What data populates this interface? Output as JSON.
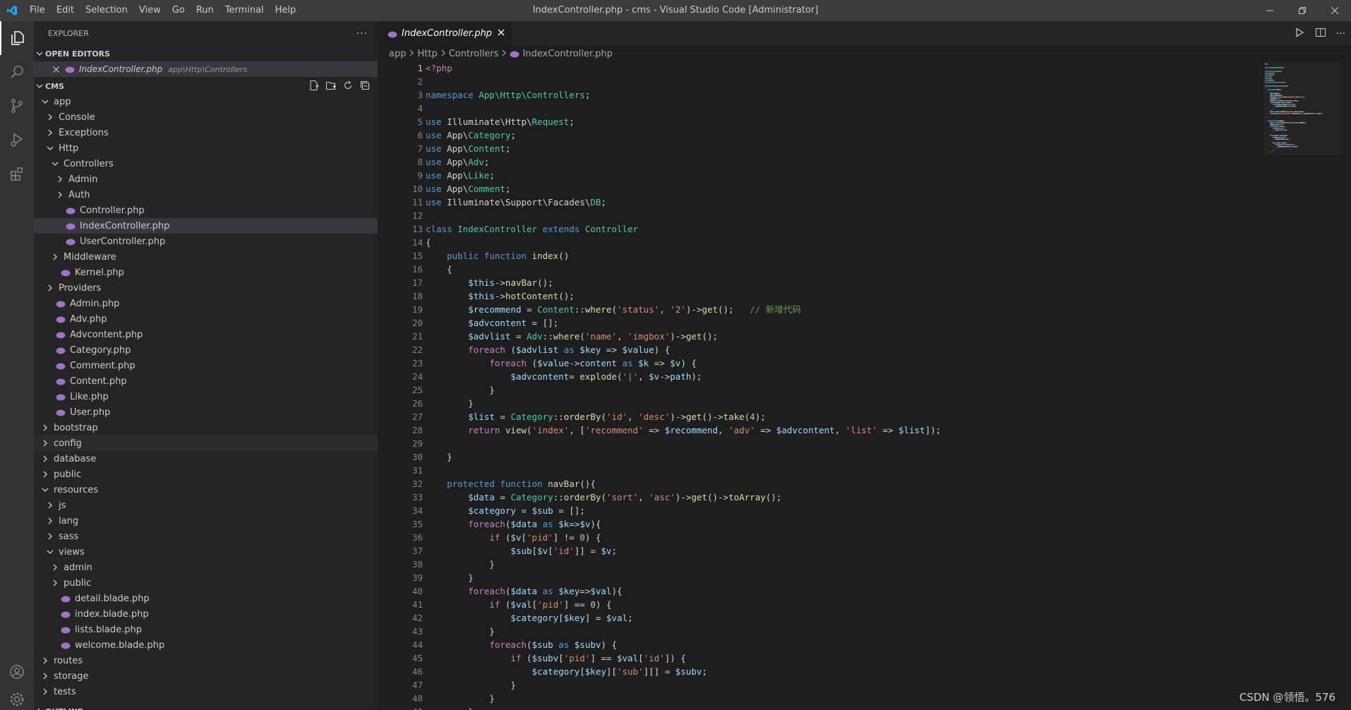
{
  "window": {
    "title": "IndexController.php - cms - Visual Studio Code [Administrator]",
    "menu": [
      "File",
      "Edit",
      "Selection",
      "View",
      "Go",
      "Run",
      "Terminal",
      "Help"
    ]
  },
  "sidebar": {
    "title": "EXPLORER",
    "open_editors_label": "OPEN EDITORS",
    "open_editor": {
      "name": "IndexController.php",
      "path": "app\\Http\\Controllers"
    },
    "project_label": "CMS",
    "tree": [
      {
        "label": "app",
        "depth": 0,
        "kind": "folder-open"
      },
      {
        "label": "Console",
        "depth": 1,
        "kind": "folder"
      },
      {
        "label": "Exceptions",
        "depth": 1,
        "kind": "folder"
      },
      {
        "label": "Http",
        "depth": 1,
        "kind": "folder-open"
      },
      {
        "label": "Controllers",
        "depth": 2,
        "kind": "folder-open"
      },
      {
        "label": "Admin",
        "depth": 3,
        "kind": "folder"
      },
      {
        "label": "Auth",
        "depth": 3,
        "kind": "folder"
      },
      {
        "label": "Controller.php",
        "depth": 3,
        "kind": "file"
      },
      {
        "label": "IndexController.php",
        "depth": 3,
        "kind": "file",
        "selected": true
      },
      {
        "label": "UserController.php",
        "depth": 3,
        "kind": "file"
      },
      {
        "label": "Middleware",
        "depth": 2,
        "kind": "folder"
      },
      {
        "label": "Kernel.php",
        "depth": 2,
        "kind": "file"
      },
      {
        "label": "Providers",
        "depth": 1,
        "kind": "folder"
      },
      {
        "label": "Admin.php",
        "depth": 1,
        "kind": "file"
      },
      {
        "label": "Adv.php",
        "depth": 1,
        "kind": "file"
      },
      {
        "label": "Advcontent.php",
        "depth": 1,
        "kind": "file"
      },
      {
        "label": "Category.php",
        "depth": 1,
        "kind": "file"
      },
      {
        "label": "Comment.php",
        "depth": 1,
        "kind": "file"
      },
      {
        "label": "Content.php",
        "depth": 1,
        "kind": "file"
      },
      {
        "label": "Like.php",
        "depth": 1,
        "kind": "file"
      },
      {
        "label": "User.php",
        "depth": 1,
        "kind": "file"
      },
      {
        "label": "bootstrap",
        "depth": 0,
        "kind": "folder"
      },
      {
        "label": "config",
        "depth": 0,
        "kind": "folder",
        "hover": true
      },
      {
        "label": "database",
        "depth": 0,
        "kind": "folder"
      },
      {
        "label": "public",
        "depth": 0,
        "kind": "folder"
      },
      {
        "label": "resources",
        "depth": 0,
        "kind": "folder-open"
      },
      {
        "label": "js",
        "depth": 1,
        "kind": "folder"
      },
      {
        "label": "lang",
        "depth": 1,
        "kind": "folder"
      },
      {
        "label": "sass",
        "depth": 1,
        "kind": "folder"
      },
      {
        "label": "views",
        "depth": 1,
        "kind": "folder-open"
      },
      {
        "label": "admin",
        "depth": 2,
        "kind": "folder"
      },
      {
        "label": "public",
        "depth": 2,
        "kind": "folder"
      },
      {
        "label": "detail.blade.php",
        "depth": 2,
        "kind": "file"
      },
      {
        "label": "index.blade.php",
        "depth": 2,
        "kind": "file"
      },
      {
        "label": "lists.blade.php",
        "depth": 2,
        "kind": "file"
      },
      {
        "label": "welcome.blade.php",
        "depth": 2,
        "kind": "file"
      },
      {
        "label": "routes",
        "depth": 0,
        "kind": "folder"
      },
      {
        "label": "storage",
        "depth": 0,
        "kind": "folder"
      },
      {
        "label": "tests",
        "depth": 0,
        "kind": "folder"
      }
    ],
    "outline_label": "OUTLINE"
  },
  "editor": {
    "tab_label": "IndexController.php",
    "breadcrumb": [
      "app",
      "Http",
      "Controllers",
      "IndexController.php"
    ],
    "lines": [
      [
        [
          "c",
          "<?php"
        ]
      ],
      [],
      [
        [
          "k",
          "namespace "
        ],
        [
          "t",
          "App\\Http\\Controllers"
        ],
        [
          "p",
          ";"
        ]
      ],
      [],
      [
        [
          "k",
          "use "
        ],
        [
          "p",
          "Illuminate\\Http\\"
        ],
        [
          "t",
          "Request"
        ],
        [
          "p",
          ";"
        ]
      ],
      [
        [
          "k",
          "use "
        ],
        [
          "p",
          "App\\"
        ],
        [
          "t",
          "Category"
        ],
        [
          "p",
          ";"
        ]
      ],
      [
        [
          "k",
          "use "
        ],
        [
          "p",
          "App\\"
        ],
        [
          "t",
          "Content"
        ],
        [
          "p",
          ";"
        ]
      ],
      [
        [
          "k",
          "use "
        ],
        [
          "p",
          "App\\"
        ],
        [
          "t",
          "Adv"
        ],
        [
          "p",
          ";"
        ]
      ],
      [
        [
          "k",
          "use "
        ],
        [
          "p",
          "App\\"
        ],
        [
          "t",
          "Like"
        ],
        [
          "p",
          ";"
        ]
      ],
      [
        [
          "k",
          "use "
        ],
        [
          "p",
          "App\\"
        ],
        [
          "t",
          "Comment"
        ],
        [
          "p",
          ";"
        ]
      ],
      [
        [
          "k",
          "use "
        ],
        [
          "p",
          "Illuminate\\Support\\Facades\\"
        ],
        [
          "t",
          "DB"
        ],
        [
          "p",
          ";"
        ]
      ],
      [],
      [
        [
          "k",
          "class "
        ],
        [
          "t",
          "IndexController "
        ],
        [
          "k",
          "extends "
        ],
        [
          "t",
          "Controller"
        ]
      ],
      [
        [
          "p",
          "{"
        ]
      ],
      [
        [
          "p",
          "    "
        ],
        [
          "k",
          "public function "
        ],
        [
          "f",
          "index"
        ],
        [
          "p",
          "()"
        ]
      ],
      [
        [
          "p",
          "    {"
        ]
      ],
      [
        [
          "p",
          "        "
        ],
        [
          "v",
          "$this"
        ],
        [
          "p",
          "->"
        ],
        [
          "f",
          "navBar"
        ],
        [
          "p",
          "();"
        ]
      ],
      [
        [
          "p",
          "        "
        ],
        [
          "v",
          "$this"
        ],
        [
          "p",
          "->"
        ],
        [
          "f",
          "hotContent"
        ],
        [
          "p",
          "();"
        ]
      ],
      [
        [
          "p",
          "        "
        ],
        [
          "v",
          "$recommend"
        ],
        [
          "p",
          " = "
        ],
        [
          "t",
          "Content"
        ],
        [
          "p",
          "::"
        ],
        [
          "f",
          "where"
        ],
        [
          "p",
          "("
        ],
        [
          "s",
          "'status'"
        ],
        [
          "p",
          ", "
        ],
        [
          "s",
          "'2'"
        ],
        [
          "p",
          ")->"
        ],
        [
          "f",
          "get"
        ],
        [
          "p",
          "();   "
        ],
        [
          "cm",
          "// 新增代码"
        ]
      ],
      [
        [
          "p",
          "        "
        ],
        [
          "v",
          "$advcontent"
        ],
        [
          "p",
          " = [];"
        ]
      ],
      [
        [
          "p",
          "        "
        ],
        [
          "v",
          "$advlist"
        ],
        [
          "p",
          " = "
        ],
        [
          "t",
          "Adv"
        ],
        [
          "p",
          "::"
        ],
        [
          "f",
          "where"
        ],
        [
          "p",
          "("
        ],
        [
          "s",
          "'name'"
        ],
        [
          "p",
          ", "
        ],
        [
          "s",
          "'imgbox'"
        ],
        [
          "p",
          ")->"
        ],
        [
          "f",
          "get"
        ],
        [
          "p",
          "();"
        ]
      ],
      [
        [
          "p",
          "        "
        ],
        [
          "c",
          "foreach "
        ],
        [
          "p",
          "("
        ],
        [
          "v",
          "$advlist"
        ],
        [
          "k",
          " as "
        ],
        [
          "v",
          "$key"
        ],
        [
          "p",
          " => "
        ],
        [
          "v",
          "$value"
        ],
        [
          "p",
          ") {"
        ]
      ],
      [
        [
          "p",
          "            "
        ],
        [
          "c",
          "foreach "
        ],
        [
          "p",
          "("
        ],
        [
          "v",
          "$value"
        ],
        [
          "p",
          "->"
        ],
        [
          "v",
          "content"
        ],
        [
          "k",
          " as "
        ],
        [
          "v",
          "$k"
        ],
        [
          "p",
          " => "
        ],
        [
          "v",
          "$v"
        ],
        [
          "p",
          ") {"
        ]
      ],
      [
        [
          "p",
          "                "
        ],
        [
          "v",
          "$advcontent"
        ],
        [
          "p",
          "= "
        ],
        [
          "f",
          "explode"
        ],
        [
          "p",
          "("
        ],
        [
          "s",
          "'|'"
        ],
        [
          "p",
          ", "
        ],
        [
          "v",
          "$v"
        ],
        [
          "p",
          "->"
        ],
        [
          "v",
          "path"
        ],
        [
          "p",
          ");"
        ]
      ],
      [
        [
          "p",
          "            }"
        ]
      ],
      [
        [
          "p",
          "        }"
        ]
      ],
      [
        [
          "p",
          "        "
        ],
        [
          "v",
          "$list"
        ],
        [
          "p",
          " = "
        ],
        [
          "t",
          "Category"
        ],
        [
          "p",
          "::"
        ],
        [
          "f",
          "orderBy"
        ],
        [
          "p",
          "("
        ],
        [
          "s",
          "'id'"
        ],
        [
          "p",
          ", "
        ],
        [
          "s",
          "'desc'"
        ],
        [
          "p",
          ")->"
        ],
        [
          "f",
          "get"
        ],
        [
          "p",
          "()->"
        ],
        [
          "f",
          "take"
        ],
        [
          "p",
          "("
        ],
        [
          "n",
          "4"
        ],
        [
          "p",
          ");"
        ]
      ],
      [
        [
          "p",
          "        "
        ],
        [
          "c",
          "return "
        ],
        [
          "f",
          "view"
        ],
        [
          "p",
          "("
        ],
        [
          "s",
          "'index'"
        ],
        [
          "p",
          ", ["
        ],
        [
          "s",
          "'recommend'"
        ],
        [
          "p",
          " => "
        ],
        [
          "v",
          "$recommend"
        ],
        [
          "p",
          ", "
        ],
        [
          "s",
          "'adv'"
        ],
        [
          "p",
          " => "
        ],
        [
          "v",
          "$advcontent"
        ],
        [
          "p",
          ", "
        ],
        [
          "s",
          "'list'"
        ],
        [
          "p",
          " => "
        ],
        [
          "v",
          "$list"
        ],
        [
          "p",
          "]);"
        ]
      ],
      [],
      [
        [
          "p",
          "    }"
        ]
      ],
      [],
      [
        [
          "p",
          "    "
        ],
        [
          "k",
          "protected function "
        ],
        [
          "f",
          "navBar"
        ],
        [
          "p",
          "(){"
        ]
      ],
      [
        [
          "p",
          "        "
        ],
        [
          "v",
          "$data"
        ],
        [
          "p",
          " = "
        ],
        [
          "t",
          "Category"
        ],
        [
          "p",
          "::"
        ],
        [
          "f",
          "orderBy"
        ],
        [
          "p",
          "("
        ],
        [
          "s",
          "'sort'"
        ],
        [
          "p",
          ", "
        ],
        [
          "s",
          "'asc'"
        ],
        [
          "p",
          ")->"
        ],
        [
          "f",
          "get"
        ],
        [
          "p",
          "()->"
        ],
        [
          "f",
          "toArray"
        ],
        [
          "p",
          "();"
        ]
      ],
      [
        [
          "p",
          "        "
        ],
        [
          "v",
          "$category"
        ],
        [
          "p",
          " = "
        ],
        [
          "v",
          "$sub"
        ],
        [
          "p",
          " = [];"
        ]
      ],
      [
        [
          "p",
          "        "
        ],
        [
          "c",
          "foreach"
        ],
        [
          "p",
          "("
        ],
        [
          "v",
          "$data"
        ],
        [
          "k",
          " as "
        ],
        [
          "v",
          "$k"
        ],
        [
          "p",
          "=>"
        ],
        [
          "v",
          "$v"
        ],
        [
          "p",
          "){"
        ]
      ],
      [
        [
          "p",
          "            "
        ],
        [
          "c",
          "if "
        ],
        [
          "p",
          "("
        ],
        [
          "v",
          "$v"
        ],
        [
          "p",
          "["
        ],
        [
          "s",
          "'pid'"
        ],
        [
          "p",
          "] != "
        ],
        [
          "n",
          "0"
        ],
        [
          "p",
          ") {"
        ]
      ],
      [
        [
          "p",
          "                "
        ],
        [
          "v",
          "$sub"
        ],
        [
          "p",
          "["
        ],
        [
          "v",
          "$v"
        ],
        [
          "p",
          "["
        ],
        [
          "s",
          "'id'"
        ],
        [
          "p",
          "]] = "
        ],
        [
          "v",
          "$v"
        ],
        [
          "p",
          ";"
        ]
      ],
      [
        [
          "p",
          "            }"
        ]
      ],
      [
        [
          "p",
          "        }"
        ]
      ],
      [
        [
          "p",
          "        "
        ],
        [
          "c",
          "foreach"
        ],
        [
          "p",
          "("
        ],
        [
          "v",
          "$data"
        ],
        [
          "k",
          " as "
        ],
        [
          "v",
          "$key"
        ],
        [
          "p",
          "=>"
        ],
        [
          "v",
          "$val"
        ],
        [
          "p",
          "){"
        ]
      ],
      [
        [
          "p",
          "            "
        ],
        [
          "c",
          "if "
        ],
        [
          "p",
          "("
        ],
        [
          "v",
          "$val"
        ],
        [
          "p",
          "["
        ],
        [
          "s",
          "'pid'"
        ],
        [
          "p",
          "] == "
        ],
        [
          "n",
          "0"
        ],
        [
          "p",
          ") {"
        ]
      ],
      [
        [
          "p",
          "                "
        ],
        [
          "v",
          "$category"
        ],
        [
          "p",
          "["
        ],
        [
          "v",
          "$key"
        ],
        [
          "p",
          "] = "
        ],
        [
          "v",
          "$val"
        ],
        [
          "p",
          ";"
        ]
      ],
      [
        [
          "p",
          "            }"
        ]
      ],
      [
        [
          "p",
          "            "
        ],
        [
          "c",
          "foreach"
        ],
        [
          "p",
          "("
        ],
        [
          "v",
          "$sub"
        ],
        [
          "k",
          " as "
        ],
        [
          "v",
          "$subv"
        ],
        [
          "p",
          ") {"
        ]
      ],
      [
        [
          "p",
          "                "
        ],
        [
          "c",
          "if "
        ],
        [
          "p",
          "("
        ],
        [
          "v",
          "$subv"
        ],
        [
          "p",
          "["
        ],
        [
          "s",
          "'pid'"
        ],
        [
          "p",
          "] == "
        ],
        [
          "v",
          "$val"
        ],
        [
          "p",
          "["
        ],
        [
          "s",
          "'id'"
        ],
        [
          "p",
          "]) {"
        ]
      ],
      [
        [
          "p",
          "                    "
        ],
        [
          "v",
          "$category"
        ],
        [
          "p",
          "["
        ],
        [
          "v",
          "$key"
        ],
        [
          "p",
          "]["
        ],
        [
          "s",
          "'sub'"
        ],
        [
          "p",
          "][] = "
        ],
        [
          "v",
          "$subv"
        ],
        [
          "p",
          ";"
        ]
      ],
      [
        [
          "p",
          "                }"
        ]
      ],
      [
        [
          "p",
          "            }"
        ]
      ],
      [
        [
          "p",
          "        }"
        ]
      ]
    ]
  },
  "watermark": "CSDN @领悟。576",
  "colors": {
    "accent": "#007acc",
    "php_icon": "#a074c4"
  }
}
